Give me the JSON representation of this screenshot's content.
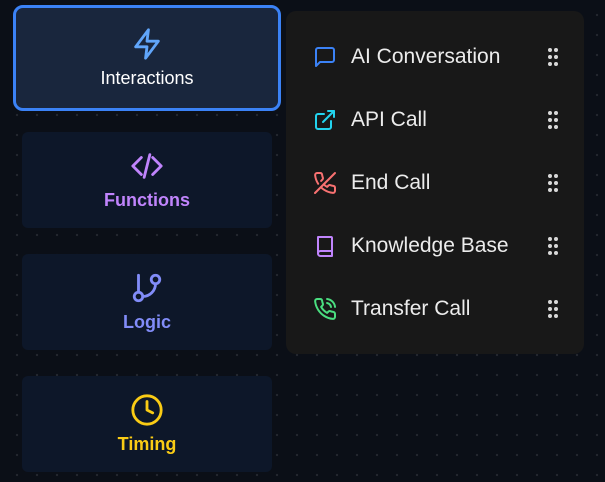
{
  "categories": [
    {
      "label": "Interactions",
      "icon": "lightning-bolt-icon",
      "color": "#60a5fa",
      "text_color": "#ffffff",
      "active": true
    },
    {
      "label": "Functions",
      "icon": "code-icon",
      "color": "#c084fc",
      "text_color": "#c084fc",
      "active": false
    },
    {
      "label": "Logic",
      "icon": "git-branch-icon",
      "color": "#818cf8",
      "text_color": "#818cf8",
      "active": false
    },
    {
      "label": "Timing",
      "icon": "clock-icon",
      "color": "#facc15",
      "text_color": "#facc15",
      "active": false
    }
  ],
  "menu": {
    "items": [
      {
        "label": "AI Conversation",
        "icon": "chat-bubble-icon",
        "color": "#3b82f6"
      },
      {
        "label": "API Call",
        "icon": "external-link-icon",
        "color": "#22d3ee"
      },
      {
        "label": "End Call",
        "icon": "phone-off-icon",
        "color": "#f87171"
      },
      {
        "label": "Knowledge Base",
        "icon": "book-icon",
        "color": "#c084fc"
      },
      {
        "label": "Transfer Call",
        "icon": "phone-forward-icon",
        "color": "#4ade80"
      }
    ]
  },
  "colors": {
    "background": "#0b0f17",
    "card": "#0d1729",
    "active_card": "#19263d",
    "active_border": "#3b82f6",
    "panel": "#181818"
  }
}
